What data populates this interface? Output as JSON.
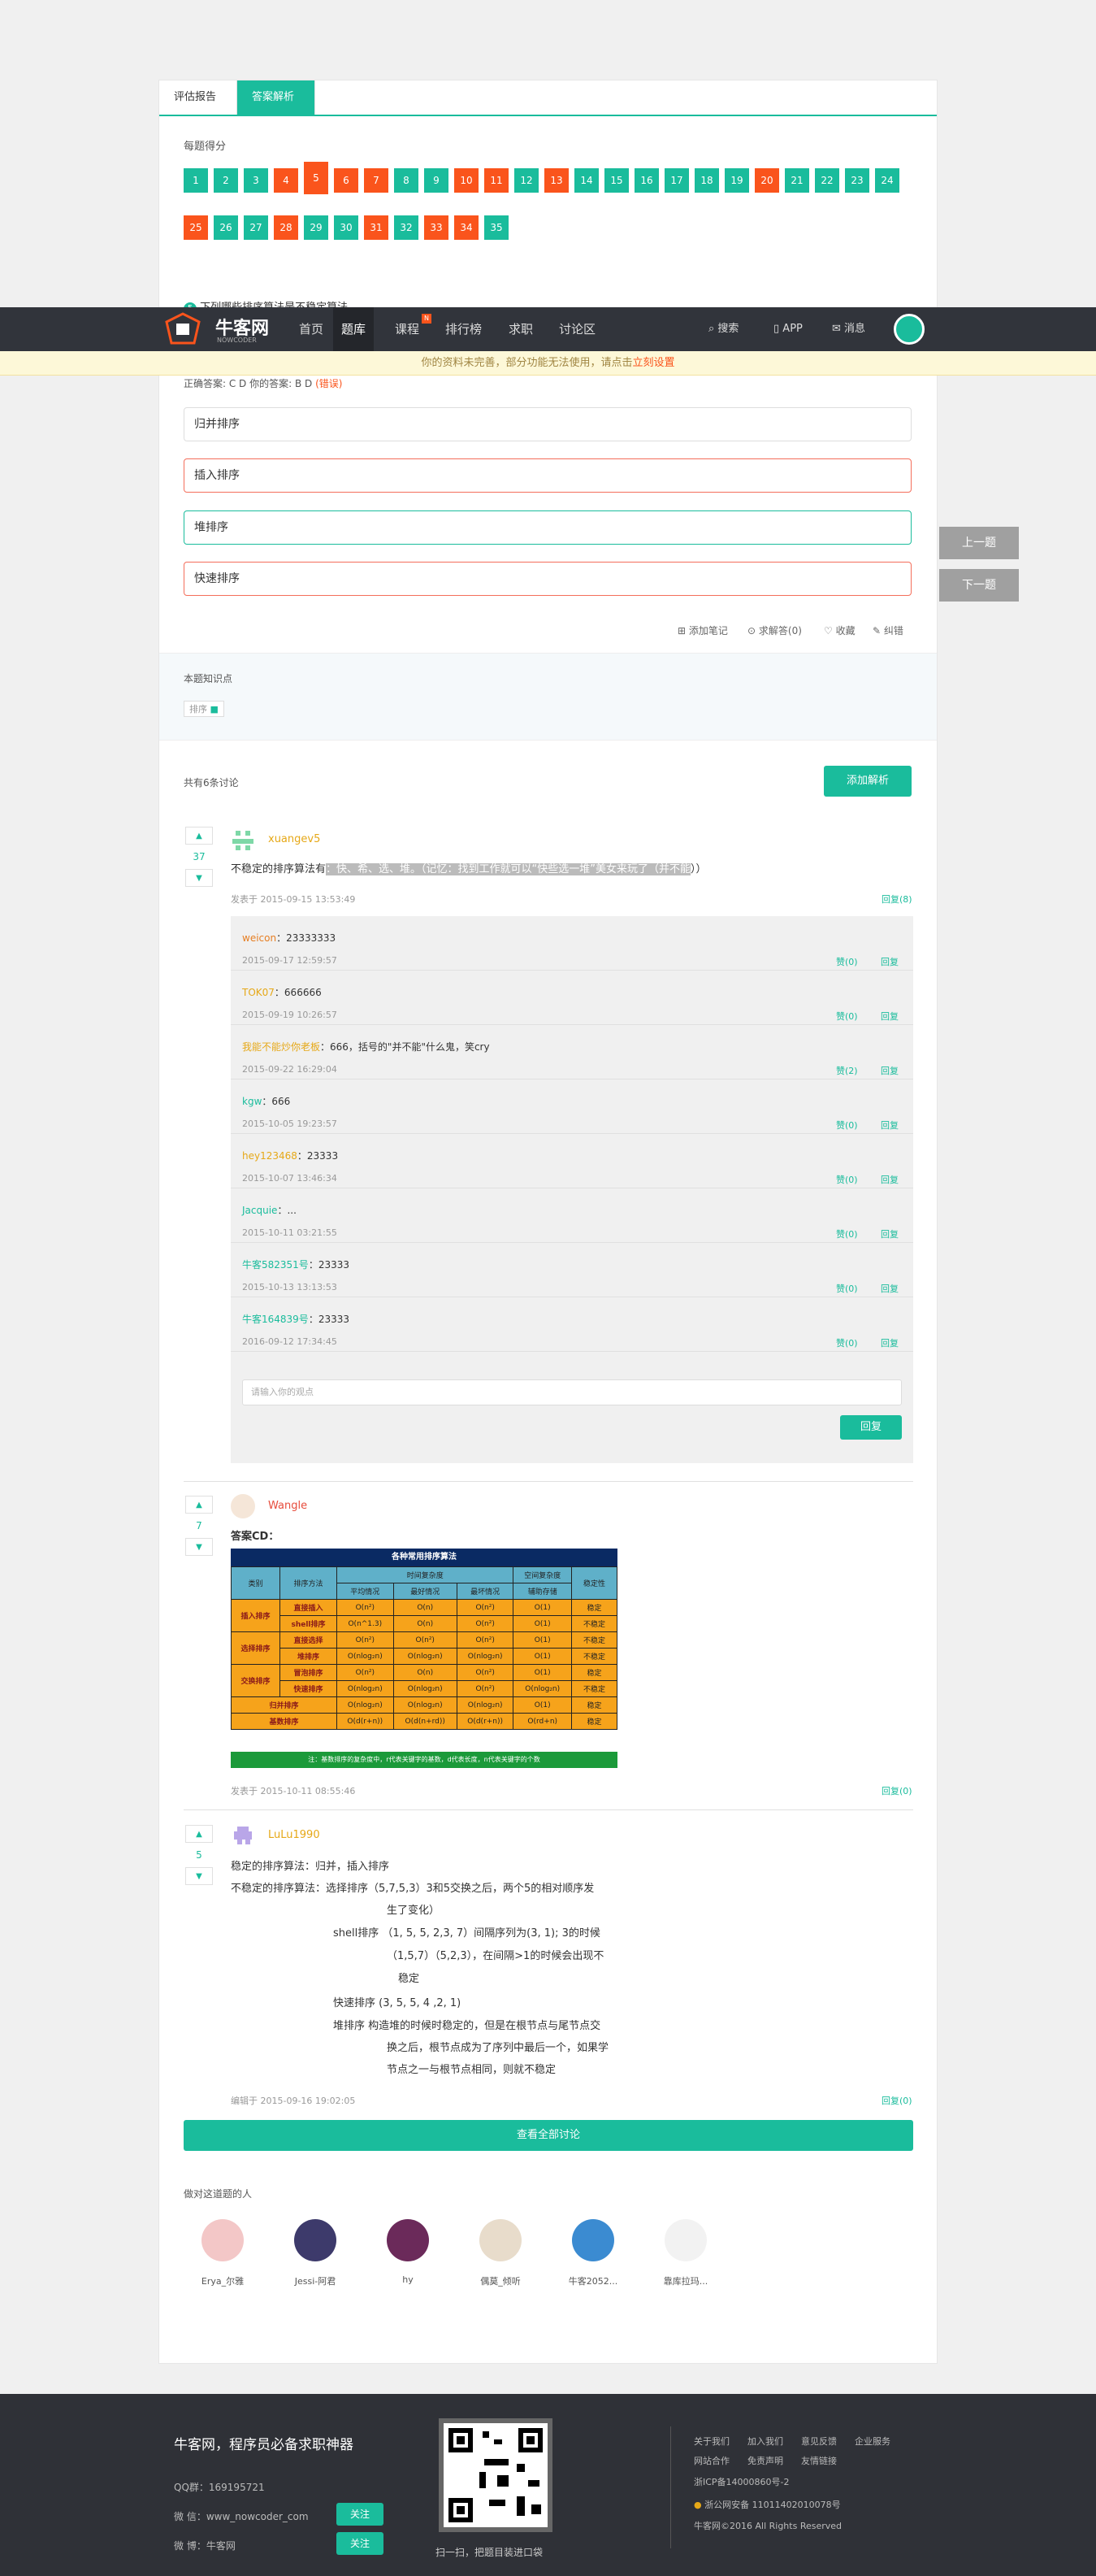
{
  "tabs": [
    "评估报告",
    "答案解析"
  ],
  "score_title": "每题得分",
  "questions": [
    {
      "n": "1",
      "s": "g"
    },
    {
      "n": "2",
      "s": "g"
    },
    {
      "n": "3",
      "s": "g"
    },
    {
      "n": "4",
      "s": "r"
    },
    {
      "n": "5",
      "s": "r"
    },
    {
      "n": "6",
      "s": "r"
    },
    {
      "n": "7",
      "s": "r"
    },
    {
      "n": "8",
      "s": "g"
    },
    {
      "n": "9",
      "s": "g"
    },
    {
      "n": "10",
      "s": "r"
    },
    {
      "n": "11",
      "s": "r"
    },
    {
      "n": "12",
      "s": "g"
    },
    {
      "n": "13",
      "s": "r"
    },
    {
      "n": "14",
      "s": "g"
    },
    {
      "n": "15",
      "s": "g"
    },
    {
      "n": "16",
      "s": "g"
    },
    {
      "n": "17",
      "s": "g"
    },
    {
      "n": "18",
      "s": "g"
    },
    {
      "n": "19",
      "s": "g"
    },
    {
      "n": "20",
      "s": "r"
    },
    {
      "n": "21",
      "s": "g"
    },
    {
      "n": "22",
      "s": "g"
    },
    {
      "n": "23",
      "s": "g"
    },
    {
      "n": "24",
      "s": "g"
    },
    {
      "n": "25",
      "s": "r"
    },
    {
      "n": "26",
      "s": "g"
    },
    {
      "n": "27",
      "s": "g"
    },
    {
      "n": "28",
      "s": "r"
    },
    {
      "n": "29",
      "s": "g"
    },
    {
      "n": "30",
      "s": "g"
    },
    {
      "n": "31",
      "s": "r"
    },
    {
      "n": "32",
      "s": "g"
    },
    {
      "n": "33",
      "s": "r"
    },
    {
      "n": "34",
      "s": "r"
    },
    {
      "n": "35",
      "s": "g"
    }
  ],
  "question_title": "下列哪些排序算法是不稳定算法",
  "nav": {
    "logo_text": "牛客网",
    "logo_sub": "NOWCODER",
    "items": [
      "首页",
      "题库",
      "课程",
      "排行榜",
      "求职",
      "讨论区"
    ],
    "new_badge": "N",
    "search": "搜索",
    "app": "APP",
    "msg": "消息"
  },
  "warning": {
    "text": "你的资料未完善，部分功能无法使用，请点击",
    "link": "立刻设置"
  },
  "answer_line": {
    "correct": "正确答案: C D  你的答案: B D",
    "status": "(错误)"
  },
  "options": [
    "归并排序",
    "插入排序",
    "堆排序",
    "快速排序"
  ],
  "side": {
    "prev": "上一题",
    "next": "下一题"
  },
  "tools": [
    "添加笔记",
    "求解答(0)",
    "收藏",
    "纠错"
  ],
  "knowledge": {
    "title": "本题知识点",
    "tag": "排序"
  },
  "discuss": {
    "count": "共有6条讨论",
    "add": "添加解析"
  },
  "post1": {
    "votes": "37",
    "user": "xuangev5",
    "text_a": "不稳定的排序算法有",
    "text_hl": "：快、希、选、堆。（记忆：找到工作就可以“快些选一堆”美女来玩了（并不能",
    "text_b": "））",
    "time": "发表于 2015-09-15 13:53:49",
    "reply": "回复(8)"
  },
  "replies": [
    {
      "user": "weicon",
      "c": "#e67e22",
      "text": "：23333333",
      "time": "2015-09-17 12:59:57",
      "zan": "赞(0)"
    },
    {
      "user": "TOK07",
      "c": "#e6a817",
      "text": "：666666",
      "time": "2015-09-19 10:26:57",
      "zan": "赞(0)"
    },
    {
      "user": "我能不能炒你老板",
      "c": "#e6a817",
      "text": "：666，括号的\"并不能\"什么鬼，笑cry",
      "time": "2015-09-22 16:29:04",
      "zan": "赞(2)"
    },
    {
      "user": "kgw",
      "c": "#1abc9c",
      "text": "：666",
      "time": "2015-10-05 19:23:57",
      "zan": "赞(0)"
    },
    {
      "user": "hey123468",
      "c": "#e6a817",
      "text": "：23333",
      "time": "2015-10-07 13:46:34",
      "zan": "赞(0)"
    },
    {
      "user": "Jacquie",
      "c": "#1abc9c",
      "text": "：...",
      "time": "2015-10-11 03:21:55",
      "zan": "赞(0)"
    },
    {
      "user": "牛客582351号",
      "c": "#1abc9c",
      "text": "：23333",
      "time": "2015-10-13 13:13:53",
      "zan": "赞(0)"
    },
    {
      "user": "牛客164839号",
      "c": "#1abc9c",
      "text": "：23333",
      "time": "2016-09-12 17:34:45",
      "zan": "赞(0)"
    }
  ],
  "reply_label": "回复",
  "reply_placeholder": "请输入你的观点",
  "reply_btn": "回复",
  "post2": {
    "votes": "7",
    "user": "Wangle",
    "text": "答案CD：",
    "time": "发表于 2015-10-11 08:55:46",
    "reply": "回复(0)"
  },
  "sort_table": {
    "title": "各种常用排序算法",
    "h1": [
      "类别",
      "排序方法",
      "时间复杂度",
      "空间复杂度",
      "稳定性"
    ],
    "h2": [
      "平均情况",
      "最好情况",
      "最坏情况",
      "辅助存储"
    ],
    "rows": [
      {
        "cat": "插入排序",
        "m": "直接插入",
        "a": "O(n²)",
        "b": "O(n)",
        "w": "O(n²)",
        "s": "O(1)",
        "st": "稳定"
      },
      {
        "cat": "",
        "m": "shell排序",
        "a": "O(n^1.3)",
        "b": "O(n)",
        "w": "O(n²)",
        "s": "O(1)",
        "st": "不稳定"
      },
      {
        "cat": "选择排序",
        "m": "直接选择",
        "a": "O(n²)",
        "b": "O(n²)",
        "w": "O(n²)",
        "s": "O(1)",
        "st": "不稳定"
      },
      {
        "cat": "",
        "m": "堆排序",
        "a": "O(nlog₂n)",
        "b": "O(nlog₂n)",
        "w": "O(nlog₂n)",
        "s": "O(1)",
        "st": "不稳定"
      },
      {
        "cat": "交换排序",
        "m": "冒泡排序",
        "a": "O(n²)",
        "b": "O(n)",
        "w": "O(n²)",
        "s": "O(1)",
        "st": "稳定"
      },
      {
        "cat": "",
        "m": "快速排序",
        "a": "O(nlog₂n)",
        "b": "O(nlog₂n)",
        "w": "O(n²)",
        "s": "O(nlog₂n)",
        "st": "不稳定"
      },
      {
        "cat": "归并排序",
        "m": "",
        "a": "O(nlog₂n)",
        "b": "O(nlog₂n)",
        "w": "O(nlog₂n)",
        "s": "O(1)",
        "st": "稳定"
      },
      {
        "cat": "基数排序",
        "m": "",
        "a": "O(d(r+n))",
        "b": "O(d(n+rd))",
        "w": "O(d(r+n))",
        "s": "O(rd+n)",
        "st": "稳定"
      }
    ],
    "note": "注：基数排序的复杂度中，r代表关键字的基数，d代表长度，n代表关键字的个数"
  },
  "post3": {
    "votes": "5",
    "user": "LuLu1990",
    "lines": [
      "稳定的排序算法：归并，插入排序",
      "不稳定的排序算法：选择排序（5,7,5,3）3和5交换之后，两个5的相对顺序发",
      "生了变化）",
      "shell排序 （1, 5, 5, 2,3, 7）间隔序列为(3, 1); 3的时候",
      "（1,5,7）（5,2,3），在间隔>1的时候会出现不",
      "稳定",
      "快速排序   (3, 5, 5, 4 ,2, 1)",
      "堆排序       构造堆的时候时稳定的，但是在根节点与尾节点交",
      "换之后，根节点成为了序列中最后一个，如果学",
      "节点之一与根节点相同，则就不稳定"
    ],
    "time": "编辑于 2015-09-16 19:02:05",
    "reply": "回复(0)"
  },
  "view_all": "查看全部讨论",
  "collectors_title": "做对这道题的人",
  "collectors": [
    "Erya_尔雅",
    "Jessi-阿君",
    "hy",
    "偶莫_倾听",
    "牛客2052...",
    "靠库拉玛..."
  ],
  "footer": {
    "slogan": "牛客网，程序员必备求职神器",
    "qq": "QQ群：169195721",
    "wechat": "微 信：www_nowcoder_com",
    "weibo": "微 博：牛客网",
    "follow": "关注",
    "scan": "扫一扫，把题目装进口袋",
    "links1": [
      "关于我们",
      "加入我们",
      "意见反馈",
      "企业服务"
    ],
    "links2": [
      "网站合作",
      "免责声明",
      "友情链接"
    ],
    "icp": "浙ICP备14000860号-2",
    "police": "浙公网安备 11011402010078号",
    "copy": "牛客网©2016 All Rights Reserved"
  }
}
